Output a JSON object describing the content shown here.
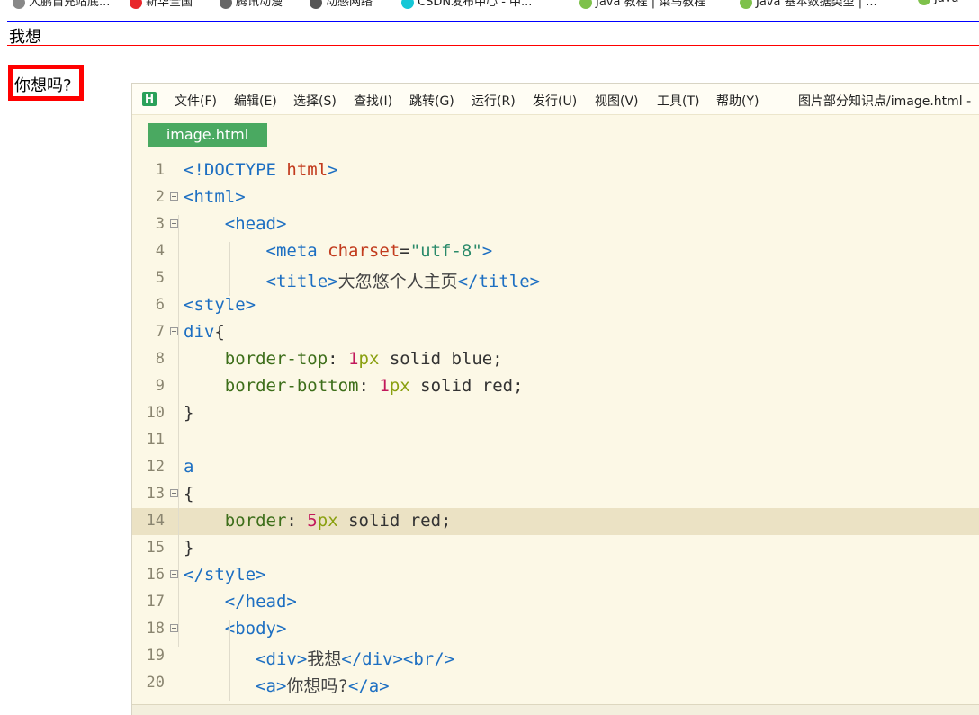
{
  "bookmarks": [
    {
      "label": "大鹏自充站底...",
      "color": "#888888"
    },
    {
      "label": "新华全国",
      "color": "#e8262a"
    },
    {
      "label": "腾讯动漫",
      "color": "#666666"
    },
    {
      "label": "动感网络",
      "color": "#555555"
    },
    {
      "label": "CSDN发布中心 - 中...",
      "color": "#16c7d6"
    },
    {
      "label": "Java 教程 | 菜鸟教程",
      "color": "#7ec14b"
    },
    {
      "label": "Java 基本数据类型 | ...",
      "color": "#7ec14b"
    },
    {
      "label": "Java",
      "color": "#7ec14b"
    }
  ],
  "preview": {
    "div_text": "我想",
    "link_text": "你想吗?"
  },
  "editor": {
    "logo": "H",
    "menu": [
      "文件(F)",
      "编辑(E)",
      "选择(S)",
      "查找(I)",
      "跳转(G)",
      "运行(R)",
      "发行(U)",
      "视图(V)",
      "工具(T)",
      "帮助(Y)"
    ],
    "title": "图片部分知识点/image.html -",
    "tab_label": "image.html",
    "highlighted_line": 14,
    "lines": [
      {
        "n": "1",
        "fold": false,
        "tokens": [
          [
            "<!DOCTYPE ",
            "#1d6fc2"
          ],
          [
            "html",
            "#c23b1d"
          ],
          [
            ">",
            "#1d6fc2"
          ]
        ]
      },
      {
        "n": "2",
        "fold": true,
        "tokens": [
          [
            "<html>",
            "#1d6fc2"
          ]
        ]
      },
      {
        "n": "3",
        "fold": true,
        "tokens": [
          [
            "    ",
            "#333"
          ],
          [
            "<head>",
            "#1d6fc2"
          ]
        ]
      },
      {
        "n": "4",
        "fold": false,
        "tokens": [
          [
            "        ",
            "#333"
          ],
          [
            "<meta ",
            "#1d6fc2"
          ],
          [
            "charset",
            "#c23b1d"
          ],
          [
            "=",
            "#333"
          ],
          [
            "\"utf-8\"",
            "#2a8a6a"
          ],
          [
            ">",
            "#1d6fc2"
          ]
        ]
      },
      {
        "n": "5",
        "fold": false,
        "tokens": [
          [
            "        ",
            "#333"
          ],
          [
            "<title>",
            "#1d6fc2"
          ],
          [
            "大忽悠个人主页",
            "#444444"
          ],
          [
            "</title>",
            "#1d6fc2"
          ]
        ]
      },
      {
        "n": "6",
        "fold": false,
        "tokens": [
          [
            "<style>",
            "#1d6fc2"
          ]
        ]
      },
      {
        "n": "7",
        "fold": true,
        "tokens": [
          [
            "div",
            "#1d6fc2"
          ],
          [
            "{",
            "#333"
          ]
        ]
      },
      {
        "n": "8",
        "fold": false,
        "tokens": [
          [
            "    ",
            "#333"
          ],
          [
            "border-top",
            "#3d6e1a"
          ],
          [
            ": ",
            "#333"
          ],
          [
            "1",
            "#c2185b"
          ],
          [
            "px",
            "#8aa010"
          ],
          [
            " solid blue;",
            "#333"
          ]
        ]
      },
      {
        "n": "9",
        "fold": false,
        "tokens": [
          [
            "    ",
            "#333"
          ],
          [
            "border-bottom",
            "#3d6e1a"
          ],
          [
            ": ",
            "#333"
          ],
          [
            "1",
            "#c2185b"
          ],
          [
            "px",
            "#8aa010"
          ],
          [
            " solid red;",
            "#333"
          ]
        ]
      },
      {
        "n": "10",
        "fold": false,
        "tokens": [
          [
            "}",
            "#333"
          ]
        ]
      },
      {
        "n": "11",
        "fold": false,
        "tokens": []
      },
      {
        "n": "12",
        "fold": false,
        "tokens": [
          [
            "a",
            "#1d6fc2"
          ]
        ]
      },
      {
        "n": "13",
        "fold": true,
        "tokens": [
          [
            "{",
            "#333"
          ]
        ]
      },
      {
        "n": "14",
        "fold": false,
        "tokens": [
          [
            "    ",
            "#333"
          ],
          [
            "border",
            "#3d6e1a"
          ],
          [
            ": ",
            "#333"
          ],
          [
            "5",
            "#c2185b"
          ],
          [
            "px",
            "#8aa010"
          ],
          [
            " solid red;",
            "#333"
          ]
        ]
      },
      {
        "n": "15",
        "fold": false,
        "tokens": [
          [
            "}",
            "#333"
          ]
        ]
      },
      {
        "n": "16",
        "fold": true,
        "tokens": [
          [
            "</style>",
            "#1d6fc2"
          ]
        ]
      },
      {
        "n": "17",
        "fold": false,
        "tokens": [
          [
            "    ",
            "#333"
          ],
          [
            "</head>",
            "#1d6fc2"
          ]
        ]
      },
      {
        "n": "18",
        "fold": true,
        "tokens": [
          [
            "    ",
            "#333"
          ],
          [
            "<body>",
            "#1d6fc2"
          ]
        ]
      },
      {
        "n": "19",
        "fold": false,
        "tokens": [
          [
            "       ",
            "#333"
          ],
          [
            "<div>",
            "#1d6fc2"
          ],
          [
            "我想",
            "#444444"
          ],
          [
            "</div><br/>",
            "#1d6fc2"
          ]
        ]
      },
      {
        "n": "20",
        "fold": false,
        "tokens": [
          [
            "       ",
            "#333"
          ],
          [
            "<a>",
            "#1d6fc2"
          ],
          [
            "你想吗?",
            "#444444"
          ],
          [
            "</a>",
            "#1d6fc2"
          ]
        ]
      }
    ]
  }
}
